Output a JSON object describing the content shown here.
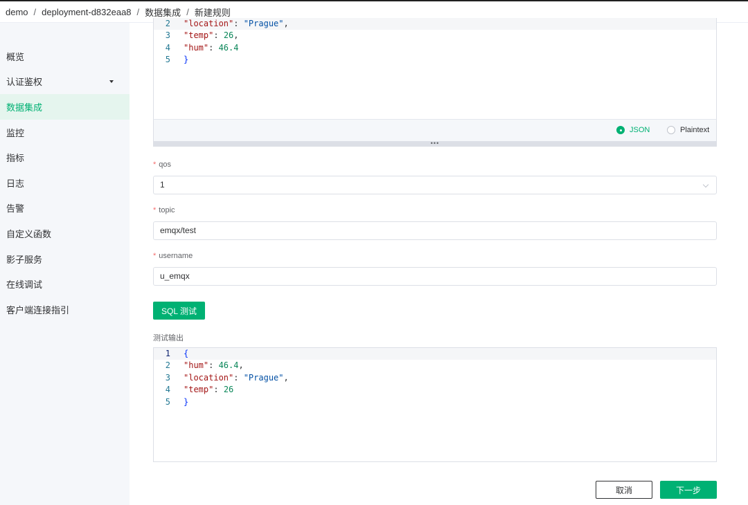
{
  "breadcrumb": [
    "demo",
    "deployment-d832eaa8",
    "数据集成",
    "新建规则"
  ],
  "sidebar": {
    "items": [
      {
        "label": "概览"
      },
      {
        "label": "认证鉴权"
      },
      {
        "label": "数据集成"
      },
      {
        "label": "监控"
      },
      {
        "label": "指标"
      },
      {
        "label": "日志"
      },
      {
        "label": "告警"
      },
      {
        "label": "自定义函数"
      },
      {
        "label": "影子服务"
      },
      {
        "label": "在线调试"
      },
      {
        "label": "客户端连接指引"
      }
    ],
    "active_index": 2
  },
  "payload_editor": {
    "lines": [
      {
        "num": "2",
        "key": "\"location\"",
        "sep": ": ",
        "value": "\"Prague\"",
        "value_type": "s",
        "tail": ","
      },
      {
        "num": "3",
        "key": "\"temp\"",
        "sep": ": ",
        "value": "26",
        "value_type": "n",
        "tail": ","
      },
      {
        "num": "4",
        "key": "\"hum\"",
        "sep": ": ",
        "value": "46.4",
        "value_type": "n",
        "tail": ""
      },
      {
        "num": "5",
        "brace": "}"
      }
    ],
    "format_json": "JSON",
    "format_plaintext": "Plaintext",
    "selected_format": "JSON",
    "resize_handle": "•••"
  },
  "fields": {
    "qos": {
      "label": "qos",
      "value": "1"
    },
    "topic": {
      "label": "topic",
      "value": "emqx/test"
    },
    "username": {
      "label": "username",
      "value": "u_emqx"
    }
  },
  "sql_test_button": "SQL 测试",
  "output": {
    "label": "测试输出",
    "lines": [
      {
        "num": "1",
        "brace": "{"
      },
      {
        "num": "2",
        "key": "\"hum\"",
        "sep": ": ",
        "value": "46.4",
        "value_type": "n",
        "tail": ","
      },
      {
        "num": "3",
        "key": "\"location\"",
        "sep": ": ",
        "value": "\"Prague\"",
        "value_type": "s",
        "tail": ","
      },
      {
        "num": "4",
        "key": "\"temp\"",
        "sep": ": ",
        "value": "26",
        "value_type": "n",
        "tail": ""
      },
      {
        "num": "5",
        "brace": "}"
      }
    ]
  },
  "footer": {
    "cancel_label": "取消",
    "next_label": "下一步"
  },
  "colors": {
    "accent": "#00b173",
    "required": "#f56c6c"
  }
}
